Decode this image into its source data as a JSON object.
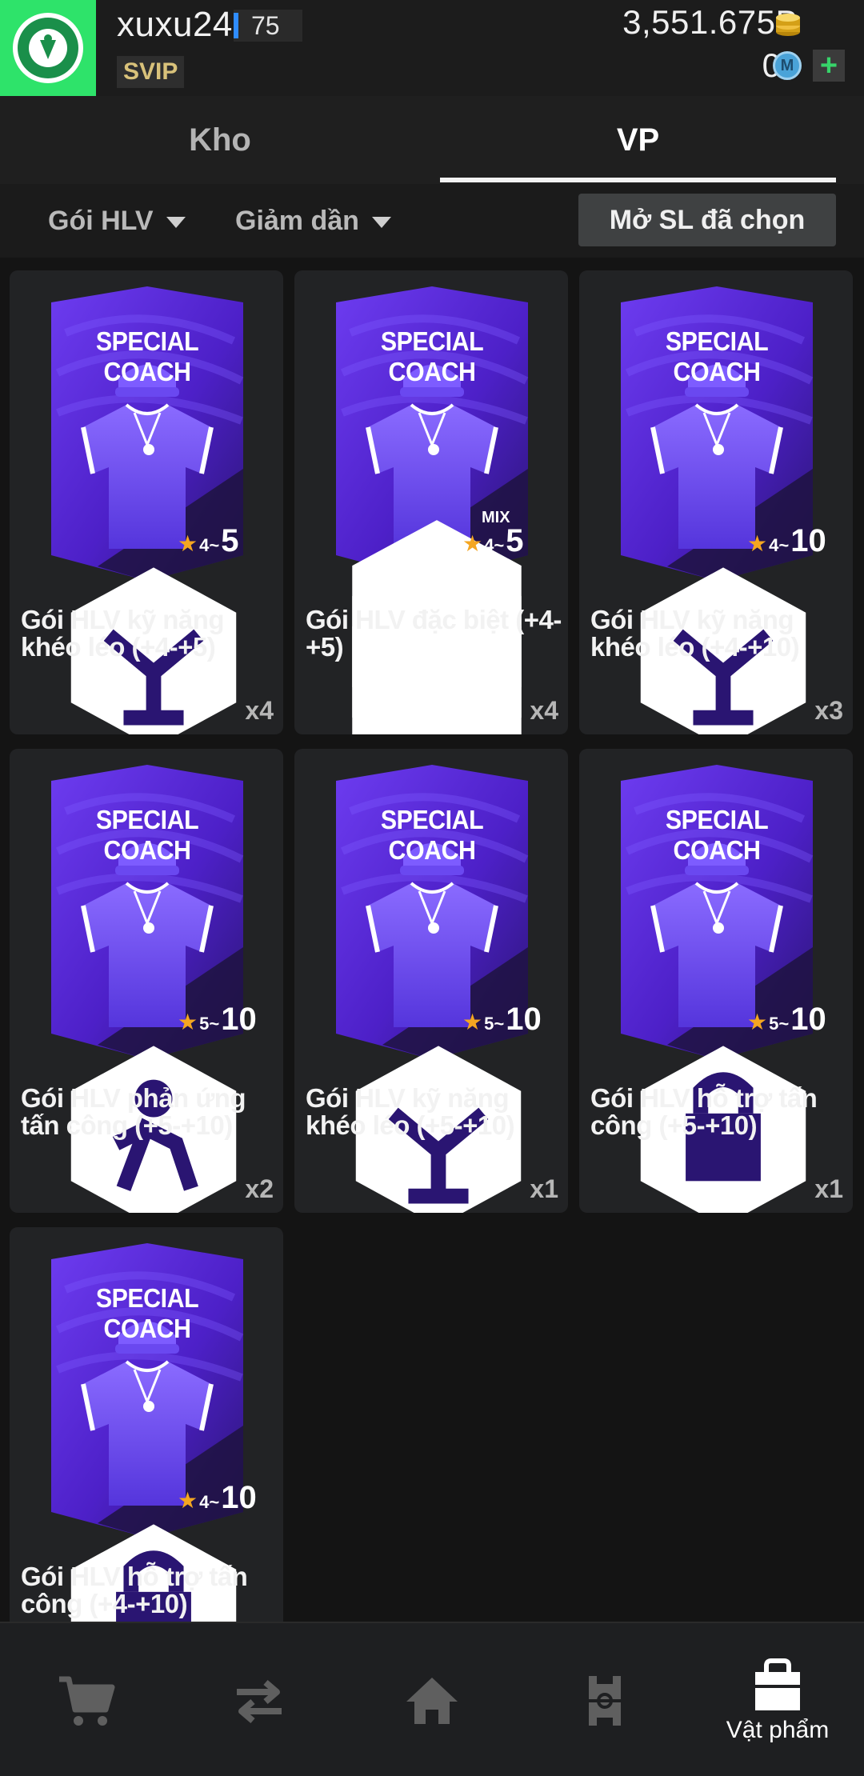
{
  "header": {
    "username": "xuxu24",
    "level": "75",
    "vip_badge": "SVIP",
    "coins": "3,551.675B",
    "m_coins": "0",
    "m_icon_glyph": "M",
    "plus_glyph": "+"
  },
  "tabs": [
    {
      "label": "Kho",
      "active": false
    },
    {
      "label": "VP",
      "active": true
    }
  ],
  "filters": {
    "type_label": "Gói HLV",
    "sort_label": "Giảm dần",
    "open_selected_label": "Mở SL đã chọn"
  },
  "pack_art_title": "SPECIAL COACH",
  "cards": [
    {
      "name": "Gói HLV kỹ năng khéo léo (+4-+5)",
      "quantity": "x4",
      "range_low": "4~",
      "range_high": "5",
      "mix": "",
      "icon": "skill-icon"
    },
    {
      "name": "Gói HLV đặc biệt (+4-+5)",
      "quantity": "x4",
      "range_low": "4~",
      "range_high": "5",
      "mix": "MIX",
      "icon": "multi-icons"
    },
    {
      "name": "Gói HLV kỹ năng khéo léo (+4-+10)",
      "quantity": "x3",
      "range_low": "4~",
      "range_high": "10",
      "mix": "",
      "icon": "skill-icon"
    },
    {
      "name": "Gói HLV phản ứng tấn công (+5-+10)",
      "quantity": "x2",
      "range_low": "5~",
      "range_high": "10",
      "mix": "",
      "icon": "reaction-icon"
    },
    {
      "name": "Gói HLV kỹ năng khéo léo (+5-+10)",
      "quantity": "x1",
      "range_low": "5~",
      "range_high": "10",
      "mix": "",
      "icon": "skill-icon"
    },
    {
      "name": "Gói HLV hỗ trợ tấn công (+5-+10)",
      "quantity": "x1",
      "range_low": "5~",
      "range_high": "10",
      "mix": "",
      "icon": "support-icon"
    },
    {
      "name": "Gói HLV hỗ trợ tấn công (+4-+10)",
      "quantity": "",
      "range_low": "4~",
      "range_high": "10",
      "mix": "",
      "icon": "support-icon"
    }
  ],
  "star_glyph": "★",
  "bottom_nav": {
    "items": [
      "shop-cart-icon",
      "transfer-arrows-icon",
      "home-icon",
      "squad-pitch-icon",
      "items-bag-icon"
    ],
    "active_label": "Vật phẩm"
  },
  "colors": {
    "pack_purple": "#5b2fe0",
    "pack_dark": "#2a1572",
    "star": "#f4a621",
    "club_green": "#2ee36a"
  }
}
